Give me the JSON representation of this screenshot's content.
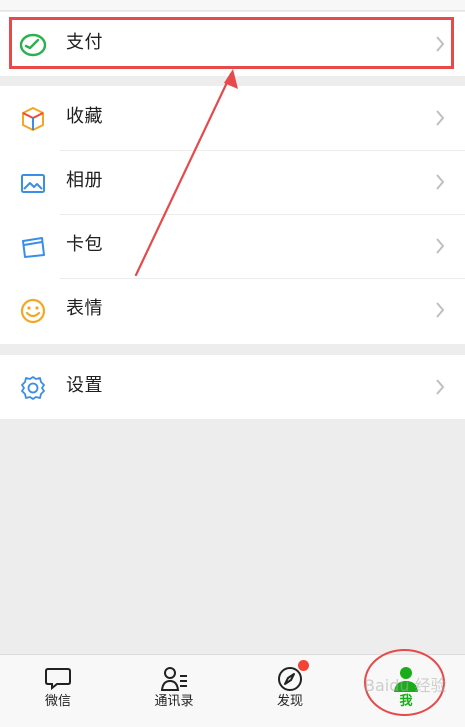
{
  "menu": {
    "pay": {
      "label": "支付",
      "icon": "wallet-icon"
    },
    "favorites": {
      "label": "收藏",
      "icon": "cube-icon"
    },
    "album": {
      "label": "相册",
      "icon": "image-icon"
    },
    "cards": {
      "label": "卡包",
      "icon": "card-icon"
    },
    "stickers": {
      "label": "表情",
      "icon": "smile-icon"
    },
    "settings": {
      "label": "设置",
      "icon": "gear-icon"
    }
  },
  "bottom_nav": {
    "items": [
      {
        "label": "微信",
        "icon": "chat-icon"
      },
      {
        "label": "通讯录",
        "icon": "contacts-icon"
      },
      {
        "label": "发现",
        "icon": "compass-icon"
      },
      {
        "label": "我",
        "icon": "person-icon"
      }
    ]
  },
  "watermark": "Baidu 经验",
  "colors": {
    "accent_green": "#1aad19",
    "annotation_red": "#e64a4a",
    "icon_blue": "#3b8ee8",
    "icon_orange": "#f5a623"
  }
}
